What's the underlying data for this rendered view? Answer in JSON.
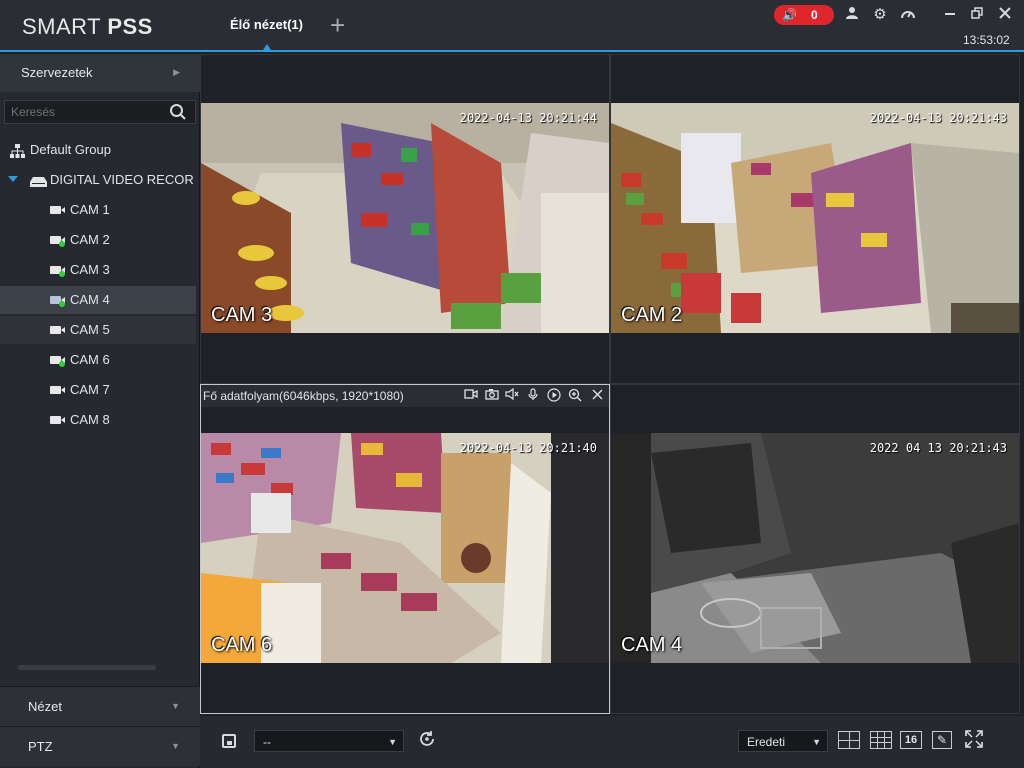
{
  "app": {
    "logo_light": "SMART ",
    "logo_bold": "PSS",
    "clock": "13:53:02"
  },
  "tabs": {
    "live_view": "Élő nézet(1)",
    "add": "+"
  },
  "alarm": {
    "count": "0",
    "color": "#e0262d"
  },
  "accent_color": "#2b9be0",
  "sidebar": {
    "organization": "Szervezetek",
    "search_placeholder": "Keresés",
    "group": "Default Group",
    "device": "DIGITAL VIDEO RECOR",
    "cameras": [
      {
        "label": "CAM 1",
        "online": false
      },
      {
        "label": "CAM 2",
        "online": true
      },
      {
        "label": "CAM 3",
        "online": true
      },
      {
        "label": "CAM 4",
        "online": true,
        "selected": true
      },
      {
        "label": "CAM 5",
        "online": false
      },
      {
        "label": "CAM 6",
        "online": true
      },
      {
        "label": "CAM 7",
        "online": false
      },
      {
        "label": "CAM 8",
        "online": false
      }
    ],
    "view_panel": "Nézet",
    "ptz_panel": "PTZ"
  },
  "video": {
    "cells": [
      {
        "cam": "CAM 3",
        "time": "2022-04-13 20:21:44"
      },
      {
        "cam": "CAM 2",
        "time": "2022-04-13 20:21:43"
      },
      {
        "cam": "CAM 6",
        "time": "2022-04-13 20:21:40"
      },
      {
        "cam": "CAM 4",
        "time": "2022 04 13 20:21:43"
      }
    ],
    "stream_info": "Fő adatfolyam(6046kbps, 1920*1080)"
  },
  "bottombar": {
    "view_select": "--",
    "ratio_select": "Eredeti",
    "layout_16": "16"
  }
}
